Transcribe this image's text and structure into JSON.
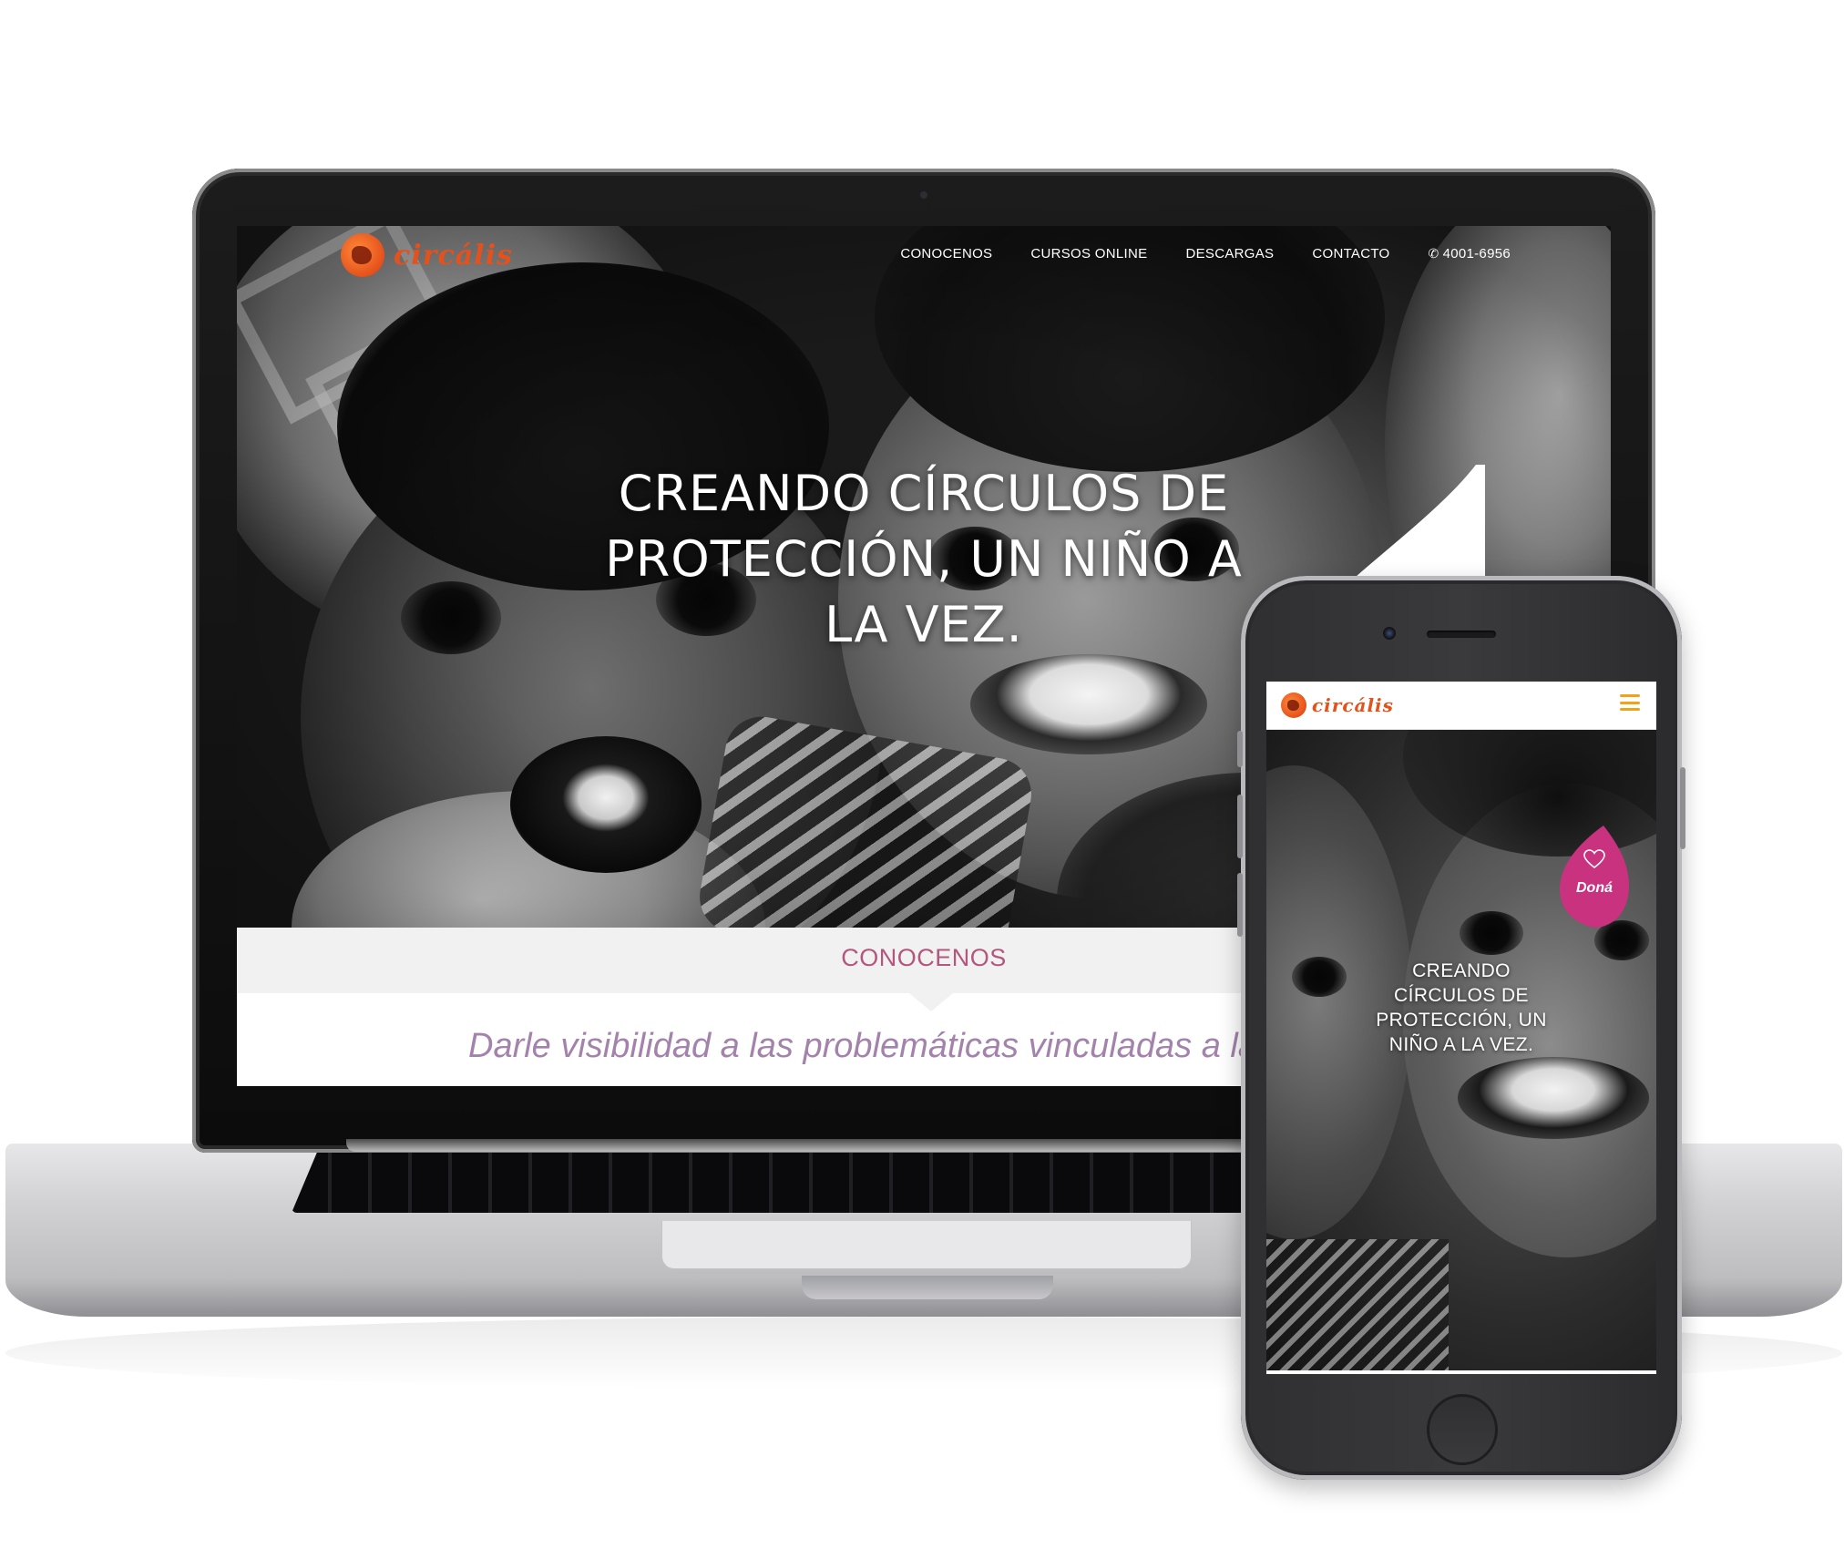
{
  "brand": {
    "name": "circális",
    "logo_color": "#e5511b"
  },
  "desktop": {
    "nav": {
      "items": [
        {
          "label": "CONOCENOS"
        },
        {
          "label": "CURSOS ONLINE"
        },
        {
          "label": "DESCARGAS"
        },
        {
          "label": "CONTACTO"
        }
      ],
      "phone": {
        "icon": "phone-icon",
        "number": "4001-6956"
      }
    },
    "hero": {
      "title_lines": [
        "CREANDO CÍRCULOS DE",
        "PROTECCIÓN, UN NIÑO A",
        "LA VEZ."
      ]
    },
    "section": {
      "title": "CONOCENOS",
      "title_color": "#b3577e",
      "text": "Darle visibilidad a las problemáticas vinculadas a la",
      "text_color": "#a383ab"
    }
  },
  "mobile": {
    "menu_icon": "hamburger-menu-icon",
    "menu_color": "#f0a319",
    "hero": {
      "title_lines": [
        "CREANDO",
        "CÍRCULOS DE",
        "PROTECCIÓN, UN",
        "NIÑO A LA VEZ."
      ]
    },
    "donate": {
      "label": "Doná",
      "icon": "heart-icon",
      "color": "#c8327f"
    }
  },
  "colors": {
    "accent_pink": "#c8327f",
    "section_bg": "#f1f1f1"
  }
}
